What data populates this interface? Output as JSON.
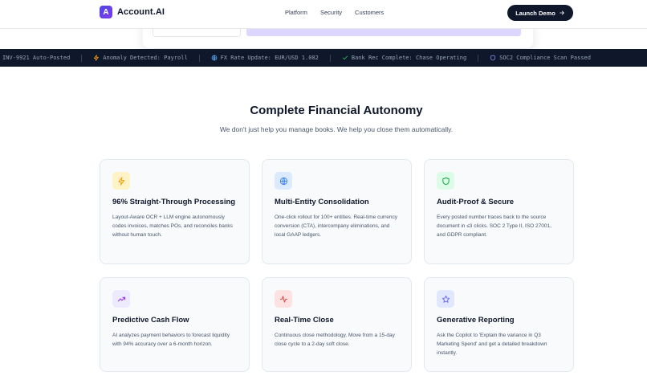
{
  "header": {
    "logo_mark": "A",
    "logo_text": "Account.AI",
    "nav": [
      "Platform",
      "Security",
      "Customers"
    ],
    "cta_label": "Launch Demo"
  },
  "ticker": {
    "items": [
      {
        "text": "INV-9921 Auto-Posted",
        "icon": "none"
      },
      {
        "text": "Anomaly Detected: Payroll",
        "icon": "zap-icon"
      },
      {
        "text": "FX Rate Update: EUR/USD 1.082",
        "icon": "globe-icon"
      },
      {
        "text": "Bank Rec Complete: Chase Operating",
        "icon": "check-icon"
      },
      {
        "text": "SOC2 Compliance Scan Passed",
        "icon": "shield-icon"
      }
    ]
  },
  "section": {
    "title": "Complete Financial Autonomy",
    "subtitle": "We don't just help you manage books. We help you close them automatically."
  },
  "cards": [
    {
      "title": "96% Straight-Through Processing",
      "body": "Layout-Aware OCR + LLM engine autonomously codes invoices, matches POs, and reconciles banks without human touch.",
      "icon": "zap-icon",
      "color": "#f59e0b"
    },
    {
      "title": "Multi-Entity Consolidation",
      "body": "One-click rollout for 100+ entities. Real-time currency conversion (CTA), intercompany eliminations, and local GAAP ledgers.",
      "icon": "globe-icon",
      "color": "#3b82f6"
    },
    {
      "title": "Audit-Proof & Secure",
      "body": "Every posted number traces back to the source document in ≤3 clicks. SOC 2 Type II, ISO 27001, and GDPR compliant.",
      "icon": "shield-icon",
      "color": "#16a34a"
    },
    {
      "title": "Predictive Cash Flow",
      "body": "AI analyzes payment behaviors to forecast liquidity with 94% accuracy over a 6-month horizon.",
      "icon": "trending-up-icon",
      "color": "#9333ea"
    },
    {
      "title": "Real-Time Close",
      "body": "Continuous close methodology. Move from a 15-day close cycle to a 2-day soft close.",
      "icon": "activity-icon",
      "color": "#ef4444"
    },
    {
      "title": "Generative Reporting",
      "body": "Ask the Copilot to 'Explain the variance in Q3 Marketing Spend' and get a detailed breakdown instantly.",
      "icon": "star-icon",
      "color": "#6366f1"
    }
  ]
}
